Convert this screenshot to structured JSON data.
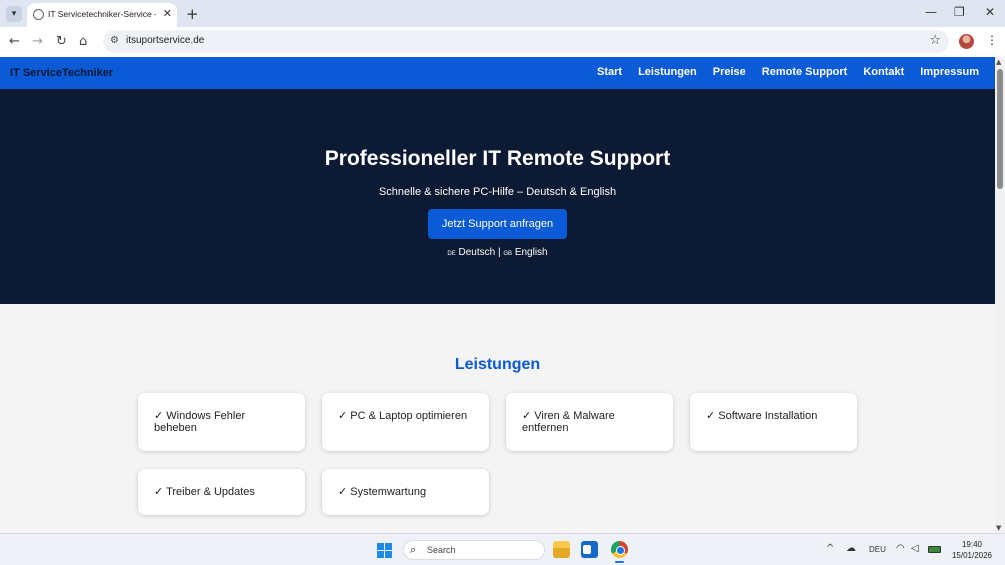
{
  "browser": {
    "tab_title": "IT Servicetechniker-Service – Re",
    "tab_close": "✕",
    "new_tab": "+",
    "tab_list_icon": "chevron-down-icon",
    "window_minimize": "—",
    "window_restore": "❐",
    "window_close": "✕",
    "nav": {
      "back": "←",
      "forward": "→",
      "reload": "↻",
      "home": "⌂"
    },
    "url": "itsuportservice.de",
    "site_info_icon": "⚙",
    "bookmark_star": "☆",
    "menu": "⋮"
  },
  "site": {
    "brand": "IT ServiceTechniker",
    "nav": [
      "Start",
      "Leistungen",
      "Preise",
      "Remote Support",
      "Kontakt",
      "Impressum"
    ],
    "hero": {
      "title": "Professioneller IT Remote Support",
      "subtitle": "Schnelle & sichere PC-Hilfe – Deutsch & English",
      "cta": "Jetzt Support anfragen",
      "lang_de_flag": "DE",
      "lang_de": "Deutsch",
      "lang_sep": "|",
      "lang_gb_flag": "GB",
      "lang_en": "English"
    },
    "services_title": "Leistungen",
    "services": [
      "✓ Windows Fehler beheben",
      "✓ PC & Laptop optimieren",
      "✓ Viren & Malware entfernen",
      "✓ Software Installation",
      "✓ Treiber & Updates",
      "✓ Systemwartung"
    ]
  },
  "scrollbar": {
    "up": "▲",
    "down": "▼"
  },
  "taskbar": {
    "search_placeholder": "Search",
    "search_icon": "⌕",
    "tray_chevron": "^",
    "tray_cloud": "☁",
    "language": "DEU",
    "wifi": "◠",
    "volume": "◁",
    "time": "19:40",
    "date": "15/01/2026"
  }
}
